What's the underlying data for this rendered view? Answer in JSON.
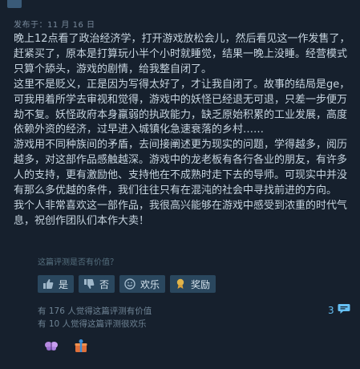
{
  "header": {
    "posted_date": "发布于：11 月 16 日"
  },
  "review": {
    "paragraphs": [
      "晚上12点看了政治经济学，打开游戏放松会儿，然后看见这一作发售了，赶紧买了，原本是打算玩小半个小时就睡觉，结果一晚上没睡。经营模式只算个舔头，游戏的剧情，给我整自闭了。",
      "这里不是贬义，正是因为写得太好了，才让我自闭了。故事的结局是ge，可我用着所学去审视和觉得，游戏中的妖怪已经退无可退，只差一步便万劫不复。妖怪政府本身羸弱的执政能力，缺乏原始积累的工业发展，高度依赖外资的经济，过早进入城镇化急速衰落的乡村……",
      "游戏用不同种族间的矛盾，去间接阐述更为现实的问题，学得越多，阅历越多，对这部作品感触越深。游戏中的龙老板有各行各业的朋友，有许多人的支持，更有激励他、支持他在不成熟时走下去的导师。可现实中并没有那么多优越的条件，我们往往只有在混沌的社会中寻找前进的方向。",
      "我个人非常喜欢这一部作品，我很高兴能够在游戏中感受到浓重的时代气息，祝创作团队们本作大卖！"
    ]
  },
  "feedback": {
    "question": "这篇评测是否有价值？",
    "yes_label": "是",
    "no_label": "否",
    "funny_label": "欢乐",
    "award_label": "奖励",
    "helpful_count_text": "有 176 人觉得这篇评测有价值",
    "funny_count_text": "有 10 人觉得这篇评测很欢乐",
    "comment_count": "3"
  },
  "icons": {
    "yes": "thumbs-up-icon",
    "no": "thumbs-down-icon",
    "funny": "smiley-icon",
    "award": "award-ribbon-icon",
    "comments": "speech-bubble-icon"
  },
  "colors": {
    "background": "#16202d",
    "text": "#c6d4df",
    "muted": "#7a8b9d",
    "button": "#2a475e",
    "link": "#66c0f4"
  }
}
